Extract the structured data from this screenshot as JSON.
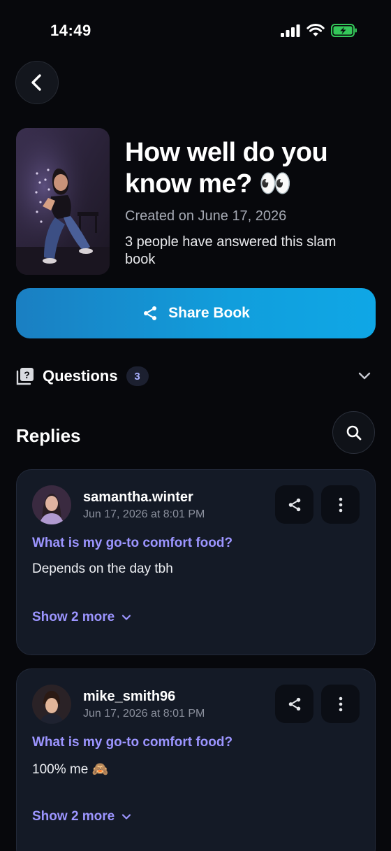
{
  "status_bar": {
    "time": "14:49"
  },
  "book": {
    "title": "How well do you know me? 👀",
    "created": "Created on June 17, 2026",
    "answered": "3 people have answered this slam book",
    "share_label": "Share Book"
  },
  "questions": {
    "label": "Questions",
    "count": "3"
  },
  "replies": {
    "title": "Replies",
    "items": [
      {
        "username": "samantha.winter",
        "timestamp": "Jun 17, 2026 at 8:01 PM",
        "question": "What is my go-to comfort food?",
        "answer": "Depends on the day tbh",
        "show_more": "Show 2 more"
      },
      {
        "username": "mike_smith96",
        "timestamp": "Jun 17, 2026 at 8:01 PM",
        "question": "What is my go-to comfort food?",
        "answer": "100% me 🙈",
        "show_more": "Show 2 more"
      }
    ]
  },
  "colors": {
    "background": "#07080c",
    "card": "#141a26",
    "accent_purple": "#9c95ff",
    "share_gradient_start": "#1a7fc2",
    "share_gradient_end": "#0fa7e6",
    "battery_green": "#34c759"
  },
  "icons": [
    "back-icon",
    "share-icon",
    "questions-icon",
    "chevron-down-icon",
    "search-icon",
    "more-icon",
    "signal-icon",
    "wifi-icon",
    "battery-icon"
  ]
}
